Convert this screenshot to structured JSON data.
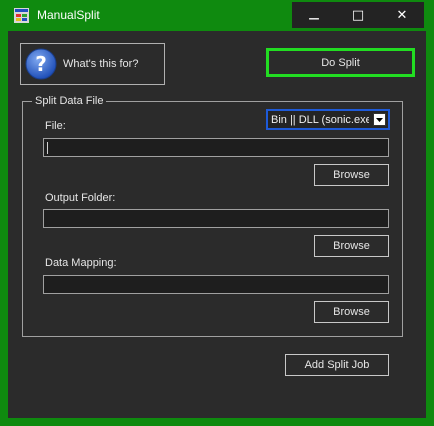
{
  "window": {
    "title": "ManualSplit",
    "minimize_glyph": "—",
    "maximize_glyph": "□",
    "close_glyph": "✕"
  },
  "toolbar": {
    "help_label": "What's this for?",
    "do_split_label": "Do Split"
  },
  "group": {
    "title": "Split Data File",
    "file_label": "File:",
    "file_value": "",
    "file_type_selected": "Bin || DLL (sonic.exe,",
    "browse_file_label": "Browse",
    "output_folder_label": "Output Folder:",
    "output_folder_value": "",
    "browse_output_label": "Browse",
    "data_mapping_label": "Data Mapping:",
    "data_mapping_value": "",
    "browse_mapping_label": "Browse"
  },
  "footer": {
    "add_split_job_label": "Add Split Job"
  },
  "colors": {
    "frame": "#0f8a0f",
    "client": "#2b2b2b",
    "do_split_border": "#22dd22",
    "combo_border": "#1e5ad8",
    "help_icon": "#2f63c8"
  },
  "icons": {
    "app": "app-window-icon",
    "help": "question-mark-icon",
    "combo": "dropdown-arrow-icon"
  }
}
